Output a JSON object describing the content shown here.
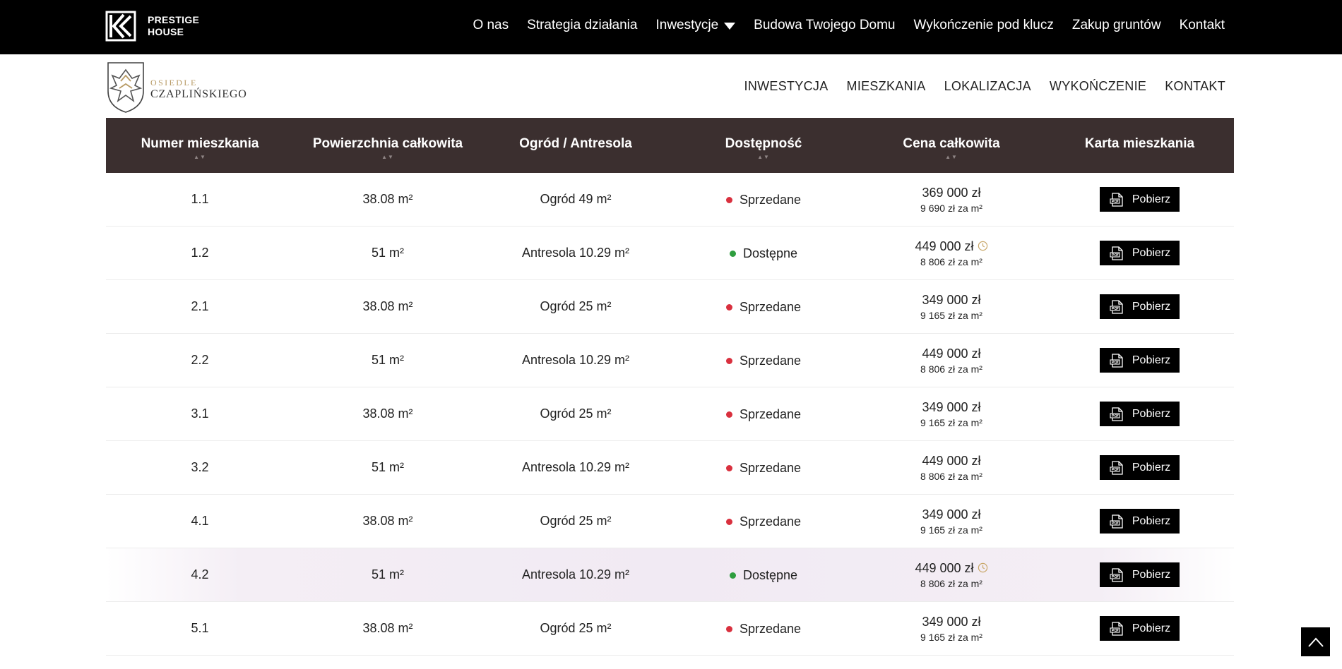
{
  "brand": {
    "line1": "PRESTIGE",
    "line2": "HOUSE"
  },
  "topnav": [
    {
      "label": "O nas"
    },
    {
      "label": "Strategia działania"
    },
    {
      "label": "Inwestycje"
    },
    {
      "label": "Budowa Twojego Domu"
    },
    {
      "label": "Wykończenie pod klucz"
    },
    {
      "label": "Zakup gruntów"
    },
    {
      "label": "Kontakt"
    }
  ],
  "estate": {
    "line1": "OSIEDLE",
    "line2": "CZAPLIŃSKIEGO"
  },
  "subnav": [
    {
      "label": "INWESTYCJA"
    },
    {
      "label": "MIESZKANIA"
    },
    {
      "label": "LOKALIZACJA"
    },
    {
      "label": "WYKOŃCZENIE"
    },
    {
      "label": "KONTAKT"
    }
  ],
  "table": {
    "headers": [
      "Numer mieszkania",
      "Powierzchnia całkowita",
      "Ogród / Antresola",
      "Dostępność",
      "Cena całkowita",
      "Karta mieszkania"
    ],
    "sort_glyph": "▲▼",
    "button_label": "Pobierz",
    "colors": {
      "sold": "#d9303e",
      "available": "#2e9e3f",
      "header_bg": "#3b2f2f"
    },
    "rows": [
      {
        "number": "1.1",
        "area": "38.08 m²",
        "extra": "Ogród 49 m²",
        "status": "Sprzedane",
        "state": "sold",
        "price": "369 000 zł",
        "ppm": "9 690 zł za m²",
        "clock": false
      },
      {
        "number": "1.2",
        "area": "51 m²",
        "extra": "Antresola 10.29 m²",
        "status": "Dostępne",
        "state": "available",
        "price": "449 000 zł",
        "ppm": "8 806 zł za m²",
        "clock": true
      },
      {
        "number": "2.1",
        "area": "38.08 m²",
        "extra": "Ogród 25 m²",
        "status": "Sprzedane",
        "state": "sold",
        "price": "349 000 zł",
        "ppm": "9 165 zł za m²",
        "clock": false
      },
      {
        "number": "2.2",
        "area": "51 m²",
        "extra": "Antresola 10.29 m²",
        "status": "Sprzedane",
        "state": "sold",
        "price": "449 000 zł",
        "ppm": "8 806 zł za m²",
        "clock": false
      },
      {
        "number": "3.1",
        "area": "38.08 m²",
        "extra": "Ogród 25 m²",
        "status": "Sprzedane",
        "state": "sold",
        "price": "349 000 zł",
        "ppm": "9 165 zł za m²",
        "clock": false
      },
      {
        "number": "3.2",
        "area": "51 m²",
        "extra": "Antresola 10.29 m²",
        "status": "Sprzedane",
        "state": "sold",
        "price": "449 000 zł",
        "ppm": "8 806 zł za m²",
        "clock": false
      },
      {
        "number": "4.1",
        "area": "38.08 m²",
        "extra": "Ogród 25 m²",
        "status": "Sprzedane",
        "state": "sold",
        "price": "349 000 zł",
        "ppm": "9 165 zł za m²",
        "clock": false
      },
      {
        "number": "4.2",
        "area": "51 m²",
        "extra": "Antresola 10.29 m²",
        "status": "Dostępne",
        "state": "available",
        "price": "449 000 zł",
        "ppm": "8 806 zł za m²",
        "clock": true,
        "highlight": true
      },
      {
        "number": "5.1",
        "area": "38.08 m²",
        "extra": "Ogród 25 m²",
        "status": "Sprzedane",
        "state": "sold",
        "price": "349 000 zł",
        "ppm": "9 165 zł za m²",
        "clock": false
      }
    ]
  }
}
